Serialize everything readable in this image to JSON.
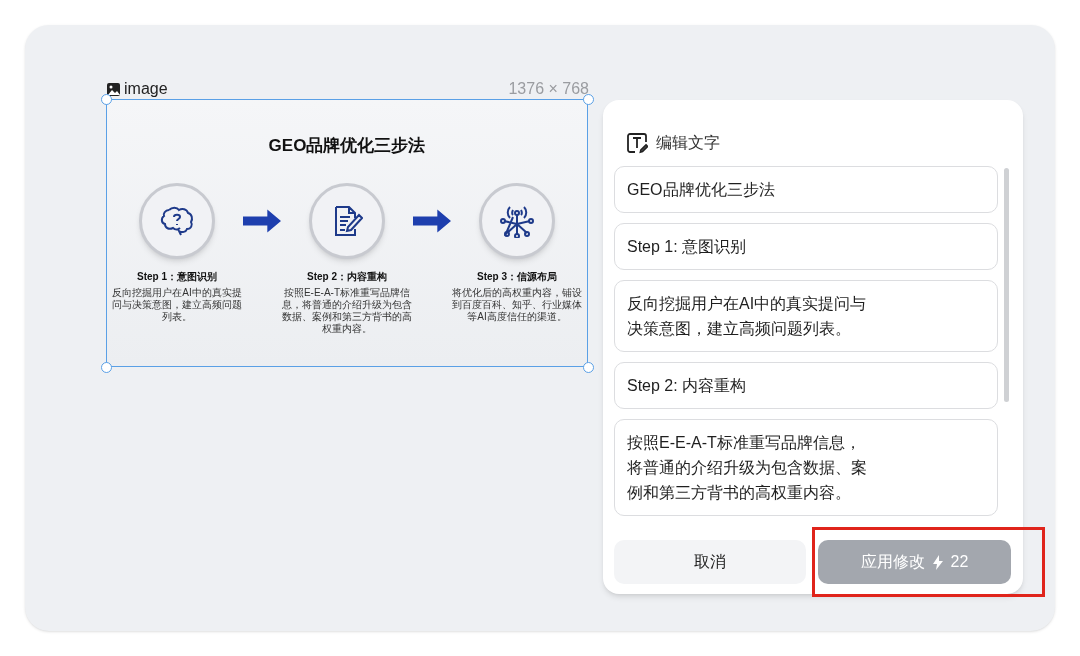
{
  "image_label": "image",
  "image_size": "1376 × 768",
  "slide": {
    "title": "GEO品牌优化三步法",
    "steps": [
      {
        "title": "Step 1：意图识别",
        "description": "反向挖掘用户在AI中的真实提问与决策意图，建立高频问题列表。"
      },
      {
        "title": "Step 2：内容重构",
        "description": "按照E-E-A-T标准重写品牌信息，将普通的介绍升级为包含数据、案例和第三方背书的高权重内容。"
      },
      {
        "title": "Step 3：信源布局",
        "description": "将优化后的高权重内容，铺设到百度百科、知乎、行业媒体等AI高度信任的渠道。"
      }
    ]
  },
  "panel": {
    "title": "编辑文字",
    "fields": [
      {
        "value": "GEO品牌优化三步法"
      },
      {
        "value": "Step 1: 意图识别"
      },
      {
        "value": "反向挖掘用户在AI中的真实提问与决策意图，建立高频问题列表。"
      },
      {
        "value": "Step 2: 内容重构"
      },
      {
        "value": "按照E-E-A-T标准重写品牌信息，将普通的介绍升级为包含数据、案例和第三方背书的高权重内容。"
      }
    ],
    "cancel": "取消",
    "apply": {
      "label": "应用修改",
      "credits": "22",
      "disabled": true
    }
  },
  "highlight_apply": true
}
